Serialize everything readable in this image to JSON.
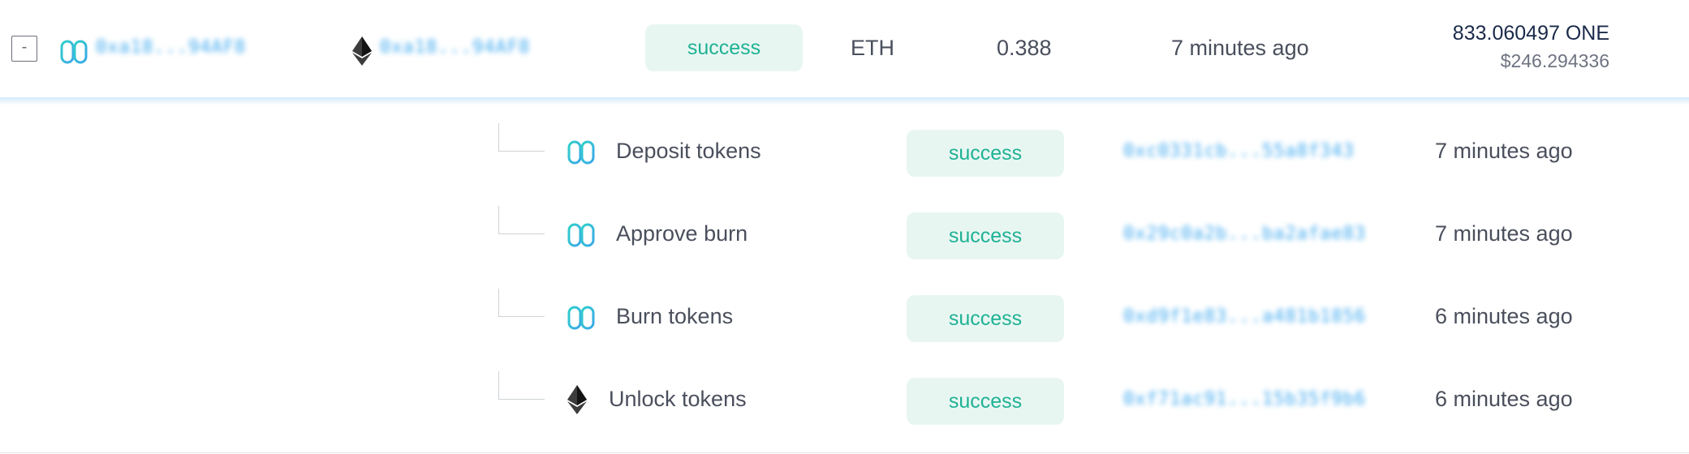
{
  "colors": {
    "accent": "#3fa9ef",
    "success_text": "#1fb294",
    "success_bg": "#e8f6f2",
    "harmony": "#35c6da"
  },
  "main_row": {
    "toggle": "-",
    "icons": [
      "harmony-icon",
      "ethereum-icon"
    ],
    "from_address": "0xa18...94AF8",
    "to_address": "0xa18...94AF8",
    "status": "success",
    "token": "ETH",
    "amount": "0.388",
    "time": "7 minutes ago",
    "fee": "833.060497 ONE",
    "fee_usd": "$246.294336"
  },
  "sub_rows": [
    {
      "icon": "harmony-icon",
      "label": "Deposit tokens",
      "status": "success",
      "hash": "0xc0331cb...55a8f343",
      "time": "7 minutes ago"
    },
    {
      "icon": "harmony-icon",
      "label": "Approve burn",
      "status": "success",
      "hash": "0x29c0a2b...ba2afae83",
      "time": "7 minutes ago"
    },
    {
      "icon": "harmony-icon",
      "label": "Burn tokens",
      "status": "success",
      "hash": "0xd9f1e83...a481b1856",
      "time": "6 minutes ago"
    },
    {
      "icon": "ethereum-icon",
      "label": "Unlock tokens",
      "status": "success",
      "hash": "0xf71ac91...15b35f9b6",
      "time": "6 minutes ago"
    }
  ]
}
